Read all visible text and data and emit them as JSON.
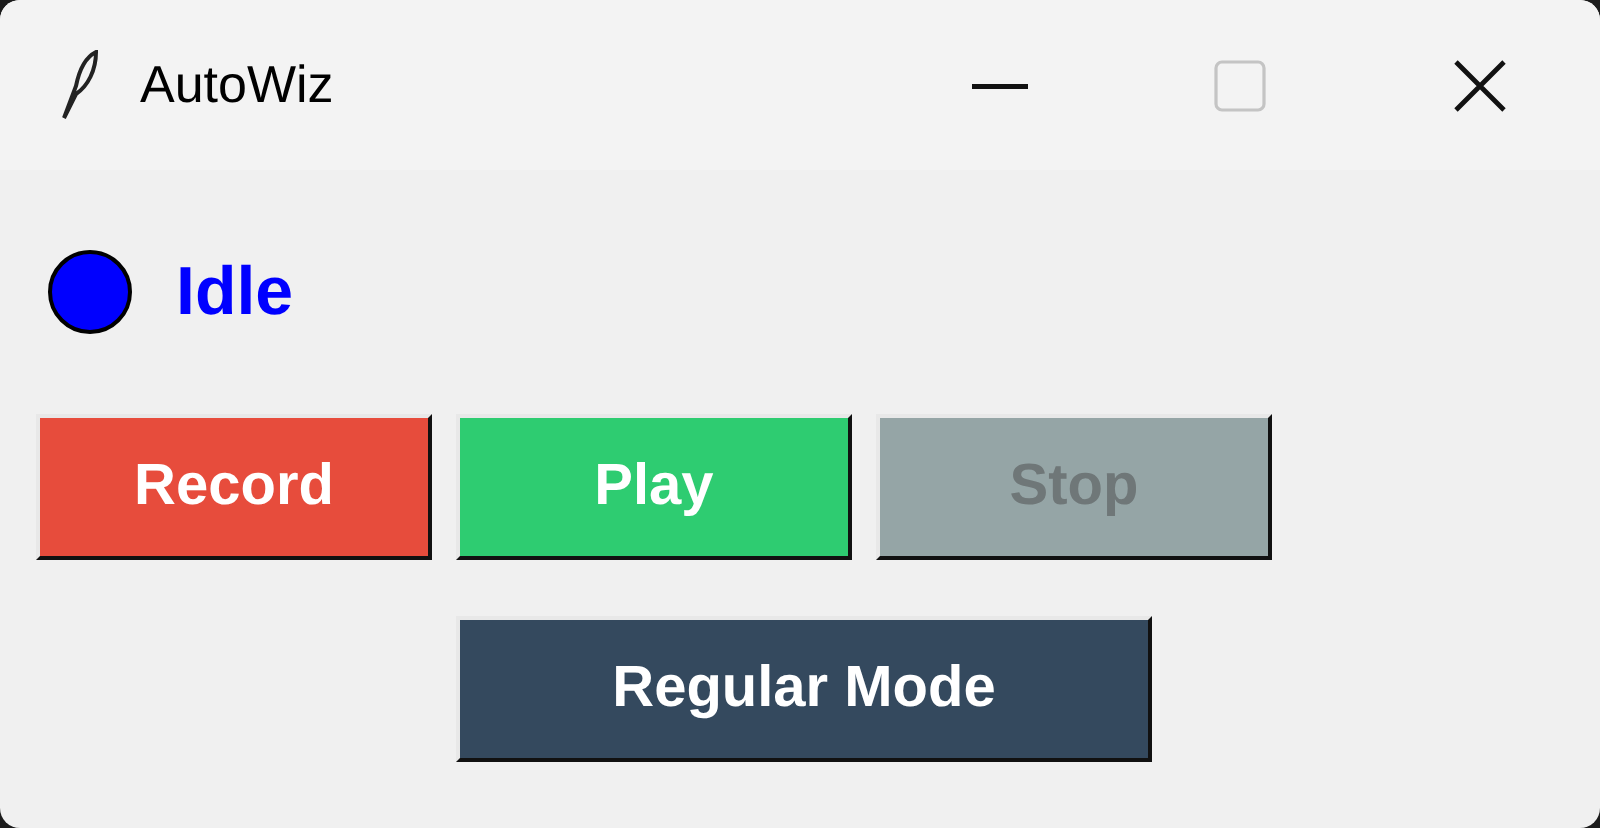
{
  "window": {
    "title": "AutoWiz",
    "controls": [
      {
        "kind": "minimize",
        "disabled": false
      },
      {
        "kind": "maximize",
        "disabled": true
      },
      {
        "kind": "close",
        "disabled": false
      }
    ]
  },
  "status": {
    "text": "Idle",
    "color": "#0000ff"
  },
  "buttons": [
    {
      "label": "Record",
      "color": "#e74c3c",
      "disabled": false
    },
    {
      "label": "Play",
      "color": "#2ecc71",
      "disabled": false
    },
    {
      "label": "Stop",
      "color": "#95a5a6",
      "disabled": true
    }
  ],
  "mode_button": {
    "label": "Regular Mode",
    "color": "#34495e"
  }
}
